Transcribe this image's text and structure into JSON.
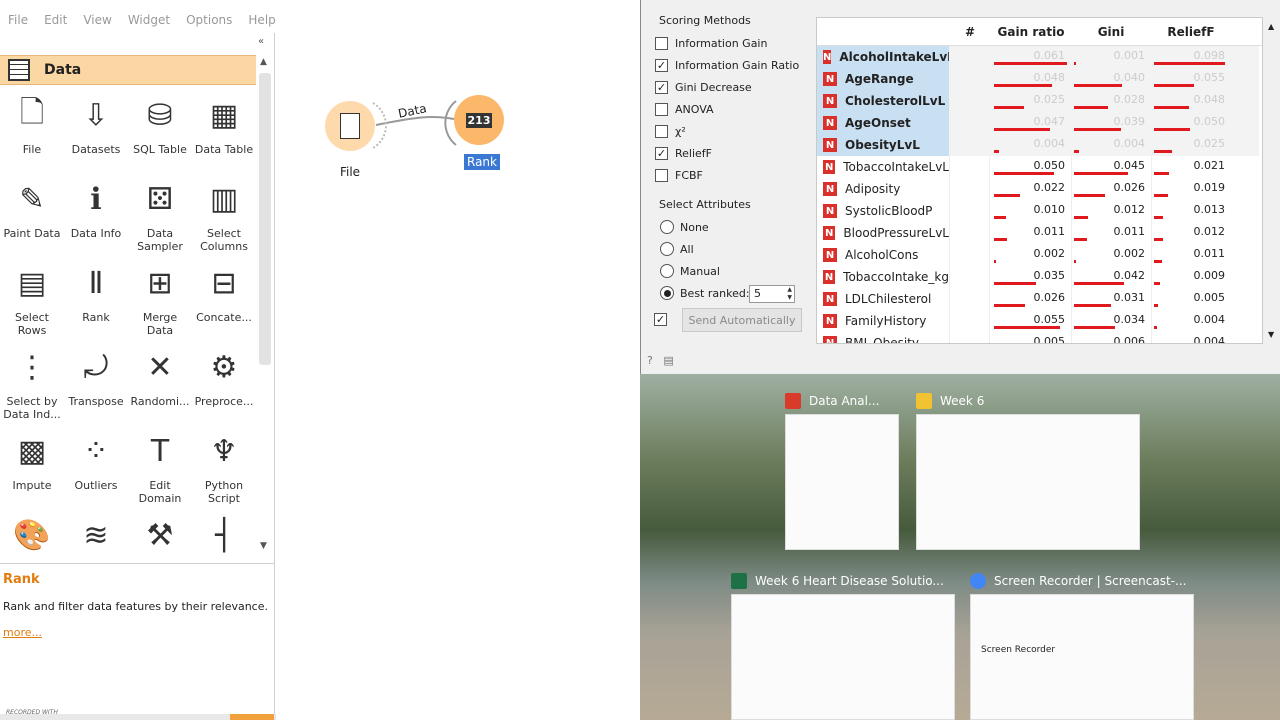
{
  "menubar": {
    "items": [
      "File",
      "Edit",
      "View",
      "Widget",
      "Options",
      "Help"
    ]
  },
  "toolbox": {
    "category": "Data",
    "widgets": [
      {
        "label": "File",
        "icon": "file-icon",
        "glyph": "🗋"
      },
      {
        "label": "Datasets",
        "icon": "datasets-icon",
        "glyph": "⇩"
      },
      {
        "label": "SQL Table",
        "icon": "sql-table-icon",
        "glyph": "⛁"
      },
      {
        "label": "Data Table",
        "icon": "data-table-icon",
        "glyph": "▦"
      },
      {
        "label": "Paint Data",
        "icon": "paint-data-icon",
        "glyph": "✎"
      },
      {
        "label": "Data Info",
        "icon": "data-info-icon",
        "glyph": "ℹ"
      },
      {
        "label": "Data Sampler",
        "icon": "data-sampler-icon",
        "glyph": "⚄"
      },
      {
        "label": "Select Columns",
        "icon": "select-columns-icon",
        "glyph": "▥"
      },
      {
        "label": "Select Rows",
        "icon": "select-rows-icon",
        "glyph": "▤"
      },
      {
        "label": "Rank",
        "icon": "rank-icon",
        "glyph": "Ⅱ"
      },
      {
        "label": "Merge Data",
        "icon": "merge-data-icon",
        "glyph": "⊞"
      },
      {
        "label": "Concate...",
        "icon": "concatenate-icon",
        "glyph": "⊟"
      },
      {
        "label": "Select by Data Ind...",
        "icon": "select-by-index-icon",
        "glyph": "⋮"
      },
      {
        "label": "Transpose",
        "icon": "transpose-icon",
        "glyph": "⤾"
      },
      {
        "label": "Randomi...",
        "icon": "randomize-icon",
        "glyph": "✕"
      },
      {
        "label": "Preproce...",
        "icon": "preprocess-icon",
        "glyph": "⚙"
      },
      {
        "label": "Impute",
        "icon": "impute-icon",
        "glyph": "▩"
      },
      {
        "label": "Outliers",
        "icon": "outliers-icon",
        "glyph": "⁘"
      },
      {
        "label": "Edit Domain",
        "icon": "edit-domain-icon",
        "glyph": "T"
      },
      {
        "label": "Python Script",
        "icon": "python-icon",
        "glyph": "♆"
      },
      {
        "label": "",
        "icon": "color-icon",
        "glyph": "🎨"
      },
      {
        "label": "",
        "icon": "create-class-icon",
        "glyph": "≋"
      },
      {
        "label": "",
        "icon": "feature-constructor-icon",
        "glyph": "⚒"
      },
      {
        "label": "",
        "icon": "discretize-icon",
        "glyph": "┤"
      }
    ]
  },
  "help": {
    "title": "Rank",
    "description": "Rank and filter data features by their relevance.",
    "more": "more..."
  },
  "recorded": "RECORDED WITH",
  "canvas": {
    "nodes": [
      {
        "label": "File"
      },
      {
        "label": "Rank"
      }
    ],
    "link_label": "Data"
  },
  "rank": {
    "scoring_title": "Scoring Methods",
    "methods": [
      {
        "label": "Information Gain",
        "checked": false
      },
      {
        "label": "Information Gain Ratio",
        "checked": true
      },
      {
        "label": "Gini Decrease",
        "checked": true
      },
      {
        "label": "ANOVA",
        "checked": false
      },
      {
        "label": "χ²",
        "checked": false
      },
      {
        "label": "ReliefF",
        "checked": true
      },
      {
        "label": "FCBF",
        "checked": false
      }
    ],
    "select_title": "Select Attributes",
    "select_options": [
      {
        "label": "None",
        "selected": false
      },
      {
        "label": "All",
        "selected": false
      },
      {
        "label": "Manual",
        "selected": false
      },
      {
        "label": "Best ranked:",
        "selected": true
      }
    ],
    "best_ranked_value": "5",
    "send_label": "Send Automatically",
    "columns": [
      "#",
      "Gain ratio",
      "Gini",
      "ReliefF"
    ],
    "rows": [
      {
        "name": "AlcoholIntakeLvL",
        "sel": true,
        "gr": "0.061",
        "gini": "0.001",
        "rf": "0.098",
        "grv": 0.061,
        "giv": 0.001,
        "rfv": 0.098
      },
      {
        "name": "AgeRange",
        "sel": true,
        "gr": "0.048",
        "gini": "0.040",
        "rf": "0.055",
        "grv": 0.048,
        "giv": 0.04,
        "rfv": 0.055
      },
      {
        "name": "CholesterolLvL",
        "sel": true,
        "gr": "0.025",
        "gini": "0.028",
        "rf": "0.048",
        "grv": 0.025,
        "giv": 0.028,
        "rfv": 0.048
      },
      {
        "name": "AgeOnset",
        "sel": true,
        "gr": "0.047",
        "gini": "0.039",
        "rf": "0.050",
        "grv": 0.047,
        "giv": 0.039,
        "rfv": 0.05
      },
      {
        "name": "ObesityLvL",
        "sel": true,
        "gr": "0.004",
        "gini": "0.004",
        "rf": "0.025",
        "grv": 0.004,
        "giv": 0.004,
        "rfv": 0.025
      },
      {
        "name": "TobaccoIntakeLvL",
        "sel": false,
        "gr": "0.050",
        "gini": "0.045",
        "rf": "0.021",
        "grv": 0.05,
        "giv": 0.045,
        "rfv": 0.021
      },
      {
        "name": "Adiposity",
        "sel": false,
        "gr": "0.022",
        "gini": "0.026",
        "rf": "0.019",
        "grv": 0.022,
        "giv": 0.026,
        "rfv": 0.019
      },
      {
        "name": "SystolicBloodP",
        "sel": false,
        "gr": "0.010",
        "gini": "0.012",
        "rf": "0.013",
        "grv": 0.01,
        "giv": 0.012,
        "rfv": 0.013
      },
      {
        "name": "BloodPressureLvL",
        "sel": false,
        "gr": "0.011",
        "gini": "0.011",
        "rf": "0.012",
        "grv": 0.011,
        "giv": 0.011,
        "rfv": 0.012
      },
      {
        "name": "AlcoholCons",
        "sel": false,
        "gr": "0.002",
        "gini": "0.002",
        "rf": "0.011",
        "grv": 0.002,
        "giv": 0.002,
        "rfv": 0.011
      },
      {
        "name": "TobaccoIntake_kg",
        "sel": false,
        "gr": "0.035",
        "gini": "0.042",
        "rf": "0.009",
        "grv": 0.035,
        "giv": 0.042,
        "rfv": 0.009
      },
      {
        "name": "LDLChilesterol",
        "sel": false,
        "gr": "0.026",
        "gini": "0.031",
        "rf": "0.005",
        "grv": 0.026,
        "giv": 0.031,
        "rfv": 0.005
      },
      {
        "name": "FamilyHistory",
        "sel": false,
        "gr": "0.055",
        "gini": "0.034",
        "rf": "0.004",
        "grv": 0.055,
        "giv": 0.034,
        "rfv": 0.004
      },
      {
        "name": "BMI_Obesity",
        "sel": false,
        "gr": "0.005",
        "gini": "0.006",
        "rf": "0.004",
        "grv": 0.005,
        "giv": 0.006,
        "rfv": 0.004
      }
    ]
  },
  "taskview": {
    "windows": [
      {
        "title": "Data Anal...",
        "icon": "pdf-icon",
        "color": "#d93b2b"
      },
      {
        "title": "Week 6",
        "icon": "folder-icon",
        "color": "#f1c232"
      },
      {
        "title": "Week 6 Heart Disease Solutio...",
        "icon": "excel-icon",
        "color": "#1e7145"
      },
      {
        "title": "Screen Recorder | Screencast-...",
        "icon": "chrome-icon",
        "color": "#4285f4"
      }
    ],
    "recorder_heading": "Screen Recorder"
  }
}
